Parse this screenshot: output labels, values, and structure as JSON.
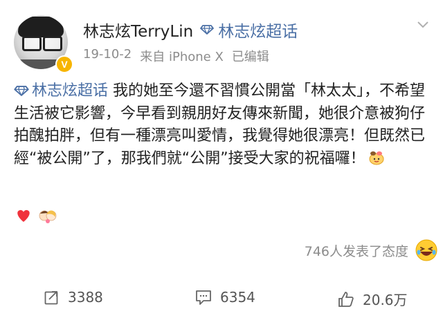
{
  "post": {
    "author": "林志炫TerryLin",
    "supertopic_link": "林志炫超话",
    "date": "19-10-2",
    "source": "来自 iPhone X",
    "edited": "已编辑",
    "body": {
      "topic": "林志炫超话",
      "text": " 我的她至今還不習慣公開當「林太太」，不希望生活被它影響，今早看到親朋好友傳來新聞，她很介意被狗仔拍醜拍胖，但有一種漂亮叫愛情，我覺得她很漂亮！但既然已經“被公開”了，那我們就“公開”接受大家的祝福囉！"
    }
  },
  "reactions": {
    "label": "746人发表了态度"
  },
  "actions": {
    "repost_count": "3388",
    "comment_count": "6354",
    "like_count": "20.6万"
  },
  "colors": {
    "link": "#4a6fa5",
    "meta": "#8c8c8c",
    "badge": "#f7b500"
  },
  "icons": [
    "verified-badge-icon",
    "supertopic-diamond-icon",
    "chevron-down-icon",
    "hug-emoji-icon",
    "heart-emoji-icon",
    "couple-emoji-icon",
    "laughing-emoji-icon",
    "repost-icon",
    "comment-icon",
    "like-icon"
  ]
}
